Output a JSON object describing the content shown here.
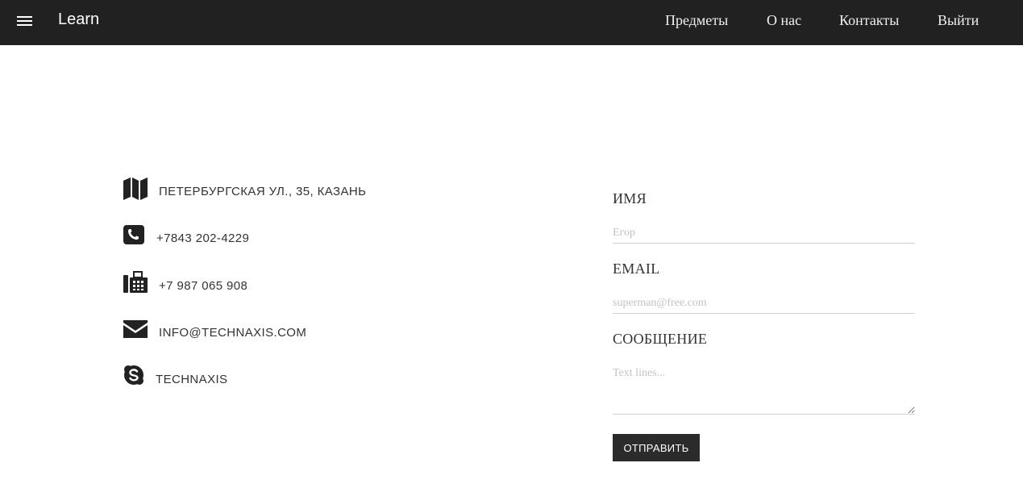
{
  "navbar": {
    "brand": "Learn",
    "menu_icon": "hamburger-menu-icon",
    "links": [
      "Предметы",
      "О нас",
      "Контакты",
      "Выйти"
    ]
  },
  "contacts": [
    {
      "icon": "map-icon",
      "text": "ПЕТЕРБУРГСКАЯ УЛ., 35, КАЗАНЬ"
    },
    {
      "icon": "phone-icon",
      "text": "+7843 202-4229"
    },
    {
      "icon": "fax-icon",
      "text": "+7 987 065 908"
    },
    {
      "icon": "envelope-icon",
      "text": "INFO@TECHNAXIS.COM"
    },
    {
      "icon": "skype-icon",
      "text": "TECHNAXIS"
    }
  ],
  "form": {
    "name_label": "ИМЯ",
    "name_placeholder": "Егор",
    "email_label": "EMAIL",
    "email_placeholder": "superman@free.com",
    "message_label": "СООБЩЕНИЕ",
    "message_placeholder": "Text lines...",
    "submit_label": "ОТПРАВИТЬ"
  },
  "colors": {
    "navbar_bg": "#212121",
    "button_bg": "#2b2b2b",
    "text": "#333333"
  }
}
